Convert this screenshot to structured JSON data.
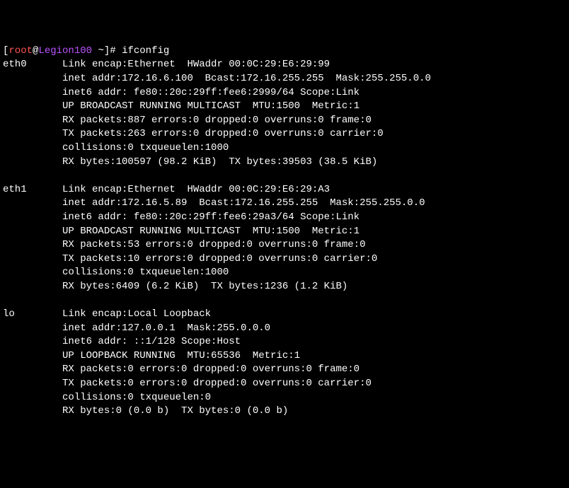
{
  "prompt": {
    "open_bracket": "[",
    "user": "root",
    "at": "@",
    "host": "Legion100",
    "path": " ~",
    "close_bracket": "]",
    "hash": "# ",
    "command": "ifconfig"
  },
  "interfaces": [
    {
      "name": "eth0",
      "lines": [
        "Link encap:Ethernet  HWaddr 00:0C:29:E6:29:99",
        "inet addr:172.16.6.100  Bcast:172.16.255.255  Mask:255.255.0.0",
        "inet6 addr: fe80::20c:29ff:fee6:2999/64 Scope:Link",
        "UP BROADCAST RUNNING MULTICAST  MTU:1500  Metric:1",
        "RX packets:887 errors:0 dropped:0 overruns:0 frame:0",
        "TX packets:263 errors:0 dropped:0 overruns:0 carrier:0",
        "collisions:0 txqueuelen:1000",
        "RX bytes:100597 (98.2 KiB)  TX bytes:39503 (38.5 KiB)"
      ]
    },
    {
      "name": "eth1",
      "lines": [
        "Link encap:Ethernet  HWaddr 00:0C:29:E6:29:A3",
        "inet addr:172.16.5.89  Bcast:172.16.255.255  Mask:255.255.0.0",
        "inet6 addr: fe80::20c:29ff:fee6:29a3/64 Scope:Link",
        "UP BROADCAST RUNNING MULTICAST  MTU:1500  Metric:1",
        "RX packets:53 errors:0 dropped:0 overruns:0 frame:0",
        "TX packets:10 errors:0 dropped:0 overruns:0 carrier:0",
        "collisions:0 txqueuelen:1000",
        "RX bytes:6409 (6.2 KiB)  TX bytes:1236 (1.2 KiB)"
      ]
    },
    {
      "name": "lo",
      "lines": [
        "Link encap:Local Loopback",
        "inet addr:127.0.0.1  Mask:255.0.0.0",
        "inet6 addr: ::1/128 Scope:Host",
        "UP LOOPBACK RUNNING  MTU:65536  Metric:1",
        "RX packets:0 errors:0 dropped:0 overruns:0 frame:0",
        "TX packets:0 errors:0 dropped:0 overruns:0 carrier:0",
        "collisions:0 txqueuelen:0",
        "RX bytes:0 (0.0 b)  TX bytes:0 (0.0 b)"
      ]
    }
  ]
}
